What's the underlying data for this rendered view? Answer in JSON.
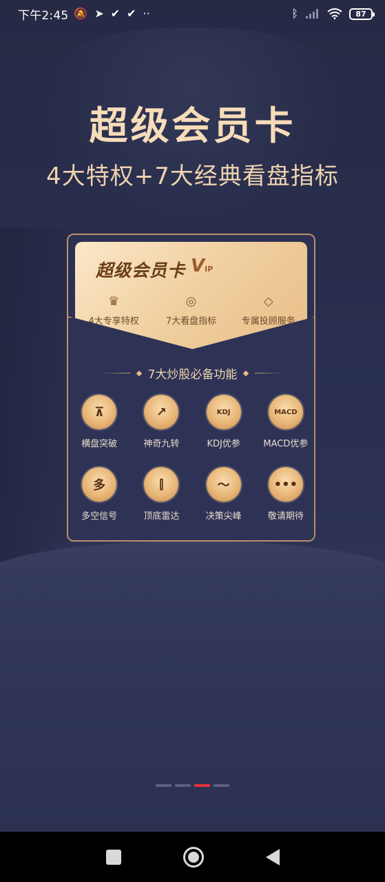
{
  "status_bar": {
    "time": "下午2:45",
    "battery": "87",
    "left_icons": [
      "mute-bell-icon",
      "telegram-icon",
      "check-icon",
      "check-icon",
      "more-dots-icon"
    ],
    "right_icons": [
      "bluetooth-icon",
      "signal-icon",
      "wifi-icon",
      "battery-icon"
    ]
  },
  "hero": {
    "title": "超级会员卡",
    "subtitle": "4大特权+7大经典看盘指标"
  },
  "vip_card": {
    "title": "超级会员卡",
    "badge": "V",
    "badge_small": "IP",
    "features": [
      {
        "icon": "crown-icon",
        "label": "4大专享特权"
      },
      {
        "icon": "gauge-icon",
        "label": "7大看盘指标"
      },
      {
        "icon": "diamond-icon",
        "label": "专属投顾服务"
      }
    ]
  },
  "section": {
    "heading": "7大炒股必备功能",
    "items": [
      {
        "icon": "presentation-chart-icon",
        "glyph": "⊼",
        "label": "横盘突破"
      },
      {
        "icon": "magic-trend-icon",
        "glyph": "↗",
        "label": "神奇九转"
      },
      {
        "icon": "kdj-cloud-icon",
        "glyph": "KDJ",
        "label": "KDJ优参"
      },
      {
        "icon": "macd-cloud-icon",
        "glyph": "MACD",
        "label": "MACD优参"
      },
      {
        "icon": "long-short-signal-icon",
        "glyph": "多",
        "label": "多空信号"
      },
      {
        "icon": "candlestick-radar-icon",
        "glyph": "⫿",
        "label": "顶底雷达"
      },
      {
        "icon": "pulse-peak-icon",
        "glyph": "〜",
        "label": "决策尖峰"
      },
      {
        "icon": "more-dots-icon",
        "glyph": "•••",
        "label": "敬请期待"
      }
    ]
  },
  "pager": {
    "count": 4,
    "active_index": 2
  },
  "colors": {
    "background": "#2b3050",
    "gold_text": "#f6dcb8",
    "card_border": "#b9926a",
    "pager_active": "#e0333b"
  }
}
